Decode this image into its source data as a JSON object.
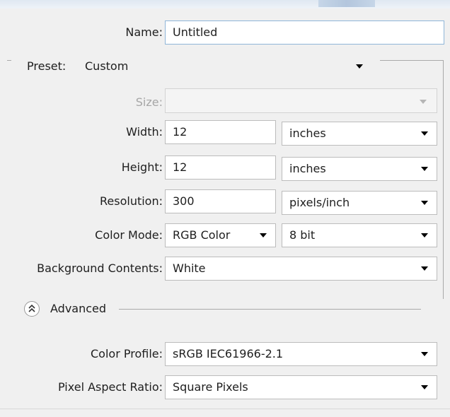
{
  "form": {
    "name_label": "Name:",
    "name_value": "Untitled",
    "preset_label": "Preset:",
    "preset_value": "Custom",
    "size_label": "Size:",
    "size_value": "",
    "width_label": "Width:",
    "width_value": "12",
    "width_unit": "inches",
    "height_label": "Height:",
    "height_value": "12",
    "height_unit": "inches",
    "resolution_label": "Resolution:",
    "resolution_value": "300",
    "resolution_unit": "pixels/inch",
    "color_mode_label": "Color Mode:",
    "color_mode_value": "RGB Color",
    "bit_depth_value": "8 bit",
    "background_label": "Background Contents:",
    "background_value": "White"
  },
  "advanced": {
    "label": "Advanced",
    "expanded": true,
    "color_profile_label": "Color Profile:",
    "color_profile_value": "sRGB IEC61966-2.1",
    "pixel_aspect_label": "Pixel Aspect Ratio:",
    "pixel_aspect_value": "Square Pixels"
  },
  "icons": {
    "advanced_toggle": "double-chevron-up-icon",
    "dropdown": "caret-down-icon"
  },
  "colors": {
    "focus_border": "#8fb6d8",
    "disabled_text": "#a6a6a6"
  }
}
